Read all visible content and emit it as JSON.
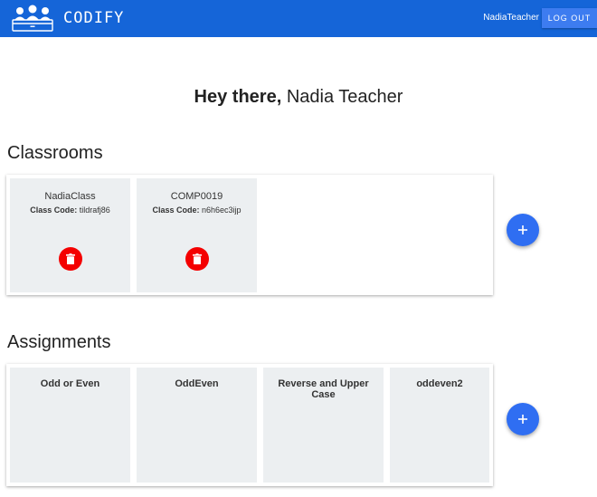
{
  "header": {
    "brand": "CODIFY",
    "username": "NadiaTeacher",
    "logout_label": "LOG OUT",
    "background_color": "#1565d8"
  },
  "greeting": {
    "prefix": "Hey there,",
    "name": "Nadia Teacher"
  },
  "classrooms": {
    "title": "Classrooms",
    "code_label": "Class Code:",
    "items": [
      {
        "name": "NadiaClass",
        "code": "tildrafj86"
      },
      {
        "name": "COMP0019",
        "code": "n6h6ec3ijp"
      }
    ],
    "add_icon": "plus-icon",
    "delete_icon": "trash-icon",
    "delete_color": "#f40000"
  },
  "assignments": {
    "title": "Assignments",
    "items": [
      {
        "name": "Odd or Even"
      },
      {
        "name": "OddEven"
      },
      {
        "name": "Reverse and Upper Case"
      },
      {
        "name": "oddeven2"
      }
    ],
    "add_icon": "plus-icon"
  },
  "accent_color": "#2f6ef2"
}
